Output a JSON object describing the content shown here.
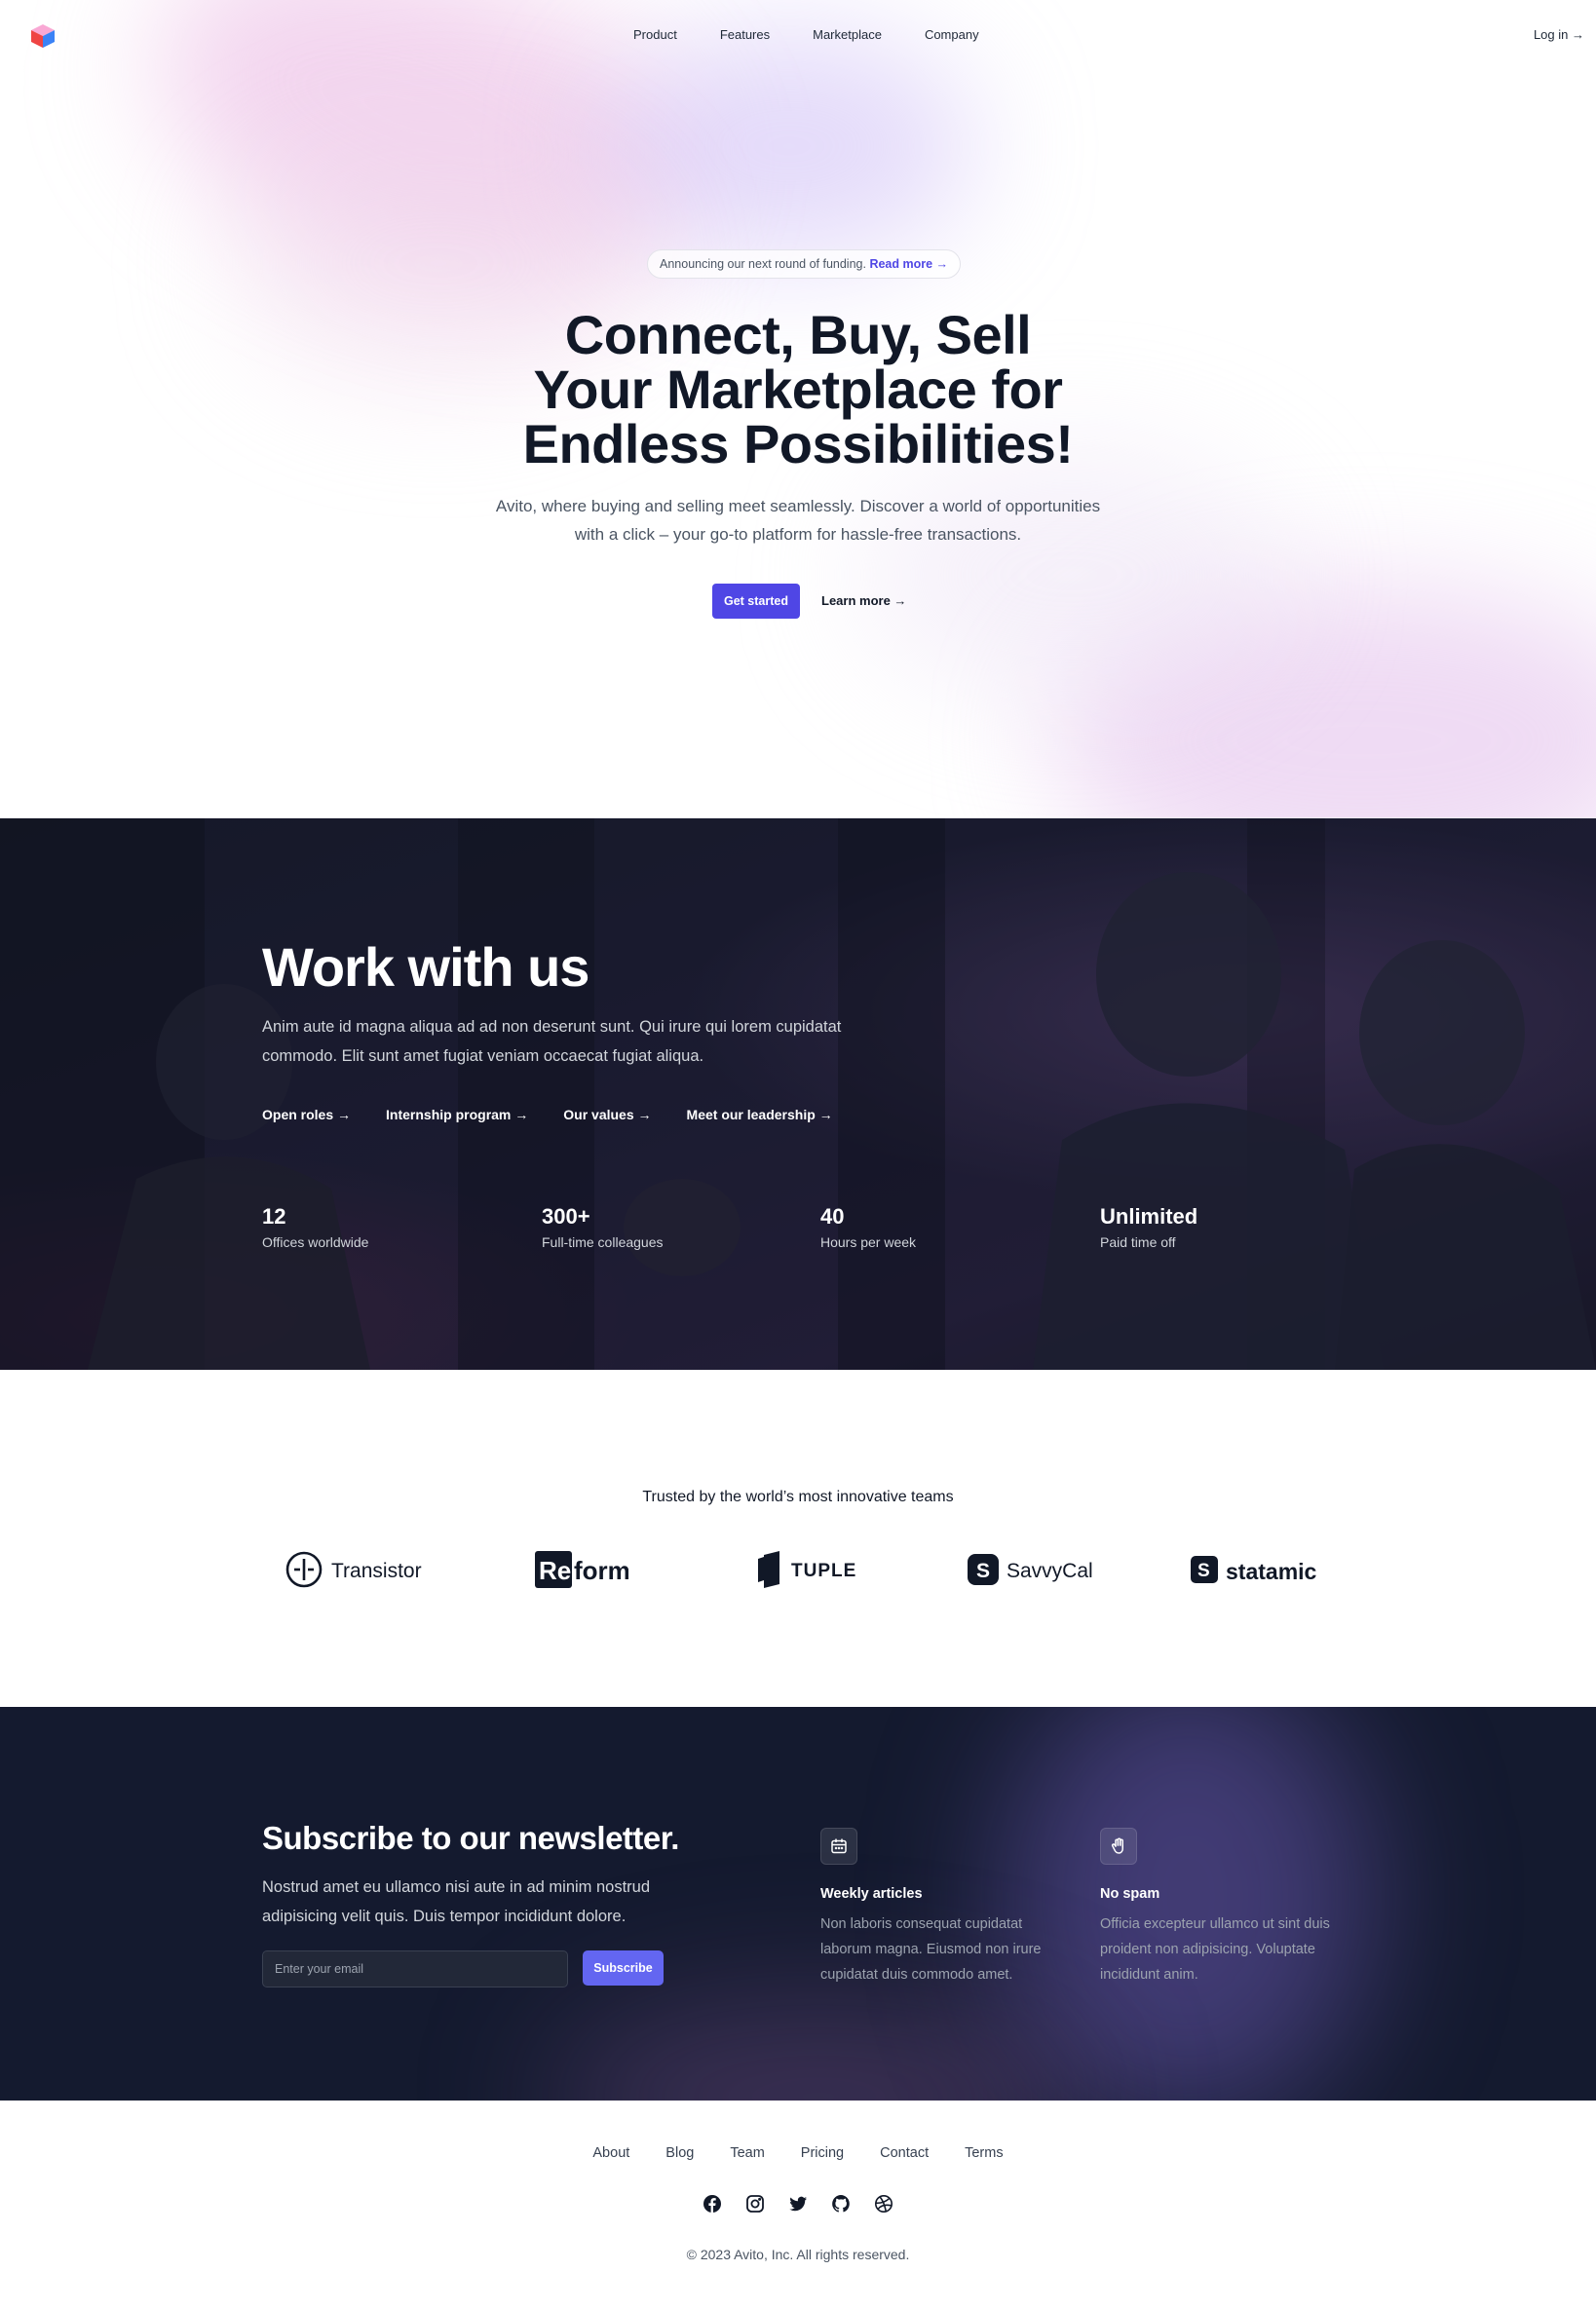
{
  "nav": {
    "logo_icon": "cube-logo-icon",
    "links": [
      "Product",
      "Features",
      "Marketplace",
      "Company"
    ],
    "login": "Log in →"
  },
  "hero": {
    "announcement": "Announcing our next round of funding.",
    "announcement_link": "Read more →",
    "title_lines": [
      "Connect, Buy, Sell",
      "Your Marketplace for",
      "Endless Possibilities!"
    ],
    "subtitle": "Avito, where buying and selling meet seamlessly. Discover a world of opportunities with a click – your go-to platform for hassle-free transactions.",
    "primary_button": "Get started",
    "secondary_link": "Learn more →",
    "accent_color": "#4f46e5"
  },
  "work": {
    "title": "Work with us",
    "description": "Anim aute id magna aliqua ad ad non deserunt sunt. Qui irure qui lorem cupidatat commodo. Elit sunt amet fugiat veniam occaecat fugiat aliqua.",
    "links": [
      "Open roles →",
      "Internship program →",
      "Our values →",
      "Meet our leadership →"
    ],
    "stats": [
      {
        "value": "12",
        "label": "Offices worldwide"
      },
      {
        "value": "300+",
        "label": "Full-time colleagues"
      },
      {
        "value": "40",
        "label": "Hours per week"
      },
      {
        "value": "Unlimited",
        "label": "Paid time off"
      }
    ]
  },
  "logos": {
    "heading": "Trusted by the world’s most innovative teams",
    "items": [
      {
        "name": "Transistor",
        "icon": "transistor-logo-icon"
      },
      {
        "name": "Reform",
        "icon": "reform-logo-icon"
      },
      {
        "name": "TUPLE",
        "icon": "tuple-logo-icon"
      },
      {
        "name": "SavvyCal",
        "icon": "savvycal-logo-icon"
      },
      {
        "name": "statamic",
        "icon": "statamic-logo-icon"
      }
    ]
  },
  "newsletter": {
    "title": "Subscribe to our newsletter.",
    "description": "Nostrud amet eu ullamco nisi aute in ad minim nostrud adipisicing velit quis. Duis tempor incididunt dolore.",
    "input_placeholder": "Enter your email",
    "button": "Subscribe",
    "features": [
      {
        "icon": "calendar-icon",
        "title": "Weekly articles",
        "description": "Non laboris consequat cupidatat laborum magna. Eiusmod non irure cupidatat duis commodo amet."
      },
      {
        "icon": "hand-raised-icon",
        "title": "No spam",
        "description": "Officia excepteur ullamco ut sint duis proident non adipisicing. Voluptate incididunt anim."
      }
    ]
  },
  "footer": {
    "links": [
      "About",
      "Blog",
      "Team",
      "Pricing",
      "Contact",
      "Terms"
    ],
    "socials": [
      "facebook-icon",
      "instagram-icon",
      "twitter-icon",
      "github-icon",
      "dribbble-icon"
    ],
    "copyright": "© 2023 Avito, Inc. All rights reserved."
  }
}
